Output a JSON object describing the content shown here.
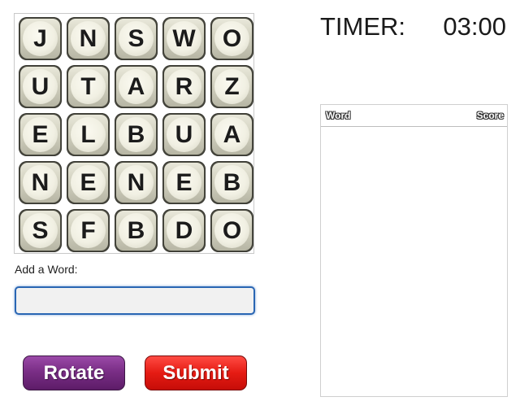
{
  "board": {
    "rows": [
      [
        "J",
        "N",
        "S",
        "W",
        "O"
      ],
      [
        "U",
        "T",
        "A",
        "R",
        "Z"
      ],
      [
        "E",
        "L",
        "B",
        "U",
        "A"
      ],
      [
        "N",
        "E",
        "N",
        "E",
        "B"
      ],
      [
        "S",
        "F",
        "B",
        "D",
        "O"
      ]
    ]
  },
  "input": {
    "label": "Add a Word:",
    "value": "",
    "placeholder": ""
  },
  "buttons": {
    "rotate": "Rotate",
    "submit": "Submit"
  },
  "timer": {
    "label": "TIMER:",
    "value": "03:00"
  },
  "score_table": {
    "col_word": "Word",
    "col_score": "Score",
    "rows": []
  },
  "colors": {
    "rotate": "#7a2e86",
    "submit": "#e51b13",
    "input_border": "#2a66b3"
  }
}
